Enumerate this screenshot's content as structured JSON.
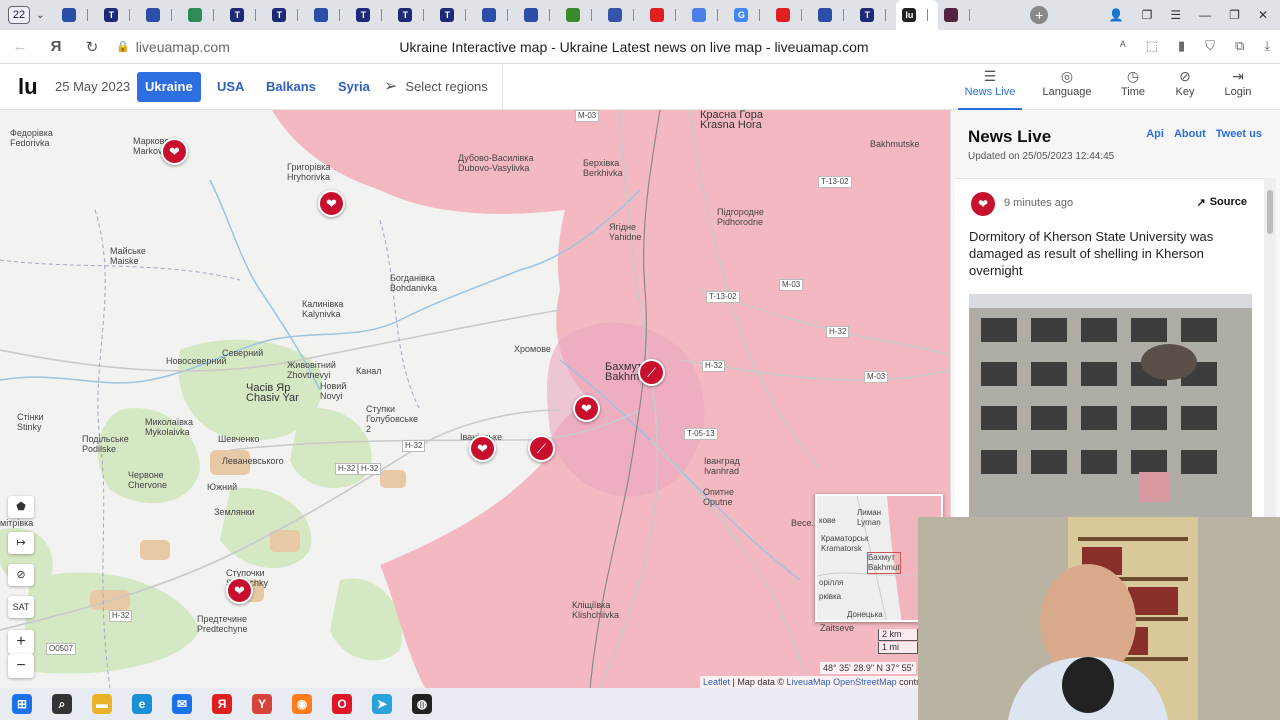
{
  "browser": {
    "tab_count": "22",
    "tabs": [
      {
        "icon": "globe-icon",
        "letter": "",
        "color": "#2b4ea8"
      },
      {
        "icon": "t-icon",
        "letter": "T",
        "color": "#1e2a78"
      },
      {
        "icon": "globe-icon",
        "letter": "",
        "color": "#2b4ea8"
      },
      {
        "icon": "sheet-icon",
        "letter": "",
        "color": "#2e8b57"
      },
      {
        "icon": "t-icon",
        "letter": "T",
        "color": "#1e2a78"
      },
      {
        "icon": "t-icon",
        "letter": "T",
        "color": "#1e2a78"
      },
      {
        "icon": "globe-icon",
        "letter": "",
        "color": "#2b4ea8"
      },
      {
        "icon": "t-icon",
        "letter": "T",
        "color": "#1e2a78"
      },
      {
        "icon": "t-icon",
        "letter": "T",
        "color": "#1e2a78"
      },
      {
        "icon": "t-icon",
        "letter": "T",
        "color": "#1e2a78"
      },
      {
        "icon": "globe-icon",
        "letter": "",
        "color": "#2b4ea8"
      },
      {
        "icon": "globe-icon",
        "letter": "",
        "color": "#2b4ea8"
      },
      {
        "icon": "rt-icon",
        "letter": "",
        "color": "#3a8a2b"
      },
      {
        "icon": "news-icon",
        "letter": "",
        "color": "#3355aa"
      },
      {
        "icon": "youtube-icon",
        "letter": "",
        "color": "#e02020"
      },
      {
        "icon": "translate-icon",
        "letter": "",
        "color": "#4a80e8"
      },
      {
        "icon": "google-icon",
        "letter": "G",
        "color": "#4285f4"
      },
      {
        "icon": "youtube-icon",
        "letter": "",
        "color": "#e02020"
      },
      {
        "icon": "globe-icon",
        "letter": "",
        "color": "#2b4ea8"
      },
      {
        "icon": "t-icon",
        "letter": "T",
        "color": "#1e2a78"
      },
      {
        "icon": "liveuamap-icon",
        "letter": "lu",
        "color": "#222222"
      },
      {
        "icon": "globe-icon",
        "letter": "",
        "color": "#552244"
      }
    ],
    "url": "liveuamap.com",
    "page_title": "Ukraine Interactive map - Ukraine Latest news on live map - liveuamap.com"
  },
  "header": {
    "logo": "lu",
    "date": "25 May 2023",
    "regions": [
      {
        "label": "Ukraine",
        "active": true
      },
      {
        "label": "USA",
        "active": false
      },
      {
        "label": "Balkans",
        "active": false
      },
      {
        "label": "Syria",
        "active": false
      }
    ],
    "select_regions": "Select regions",
    "nav": [
      {
        "label": "News Live",
        "icon": "news-icon",
        "glyph": "☰",
        "active": true
      },
      {
        "label": "Language",
        "icon": "language-icon",
        "glyph": "◎",
        "active": false
      },
      {
        "label": "Time",
        "icon": "clock-icon",
        "glyph": "◷",
        "active": false
      },
      {
        "label": "Key",
        "icon": "compass-icon",
        "glyph": "⊘",
        "active": false
      },
      {
        "label": "Login",
        "icon": "login-icon",
        "glyph": "⇥",
        "active": false
      }
    ]
  },
  "map": {
    "colors": {
      "occupied": "#f3b5bd",
      "base": "#f2f2f0",
      "marker": "#c8102e"
    },
    "labels": [
      {
        "text": "Федорівка\nFedorivka"
      },
      {
        "text": "Маркове\nMarkove"
      },
      {
        "text": "Григорівка\nHryhorivka"
      },
      {
        "text": "Майське\nMaiske"
      },
      {
        "text": "Богданівка\nBohdanivka"
      },
      {
        "text": "Калинівка\nKalynivka"
      },
      {
        "text": "Новосеверний"
      },
      {
        "text": "Северний"
      },
      {
        "text": "Живовітний\nZhovtnevyi"
      },
      {
        "text": "Часів Яр\nChasiv Yar"
      },
      {
        "text": "Новий\nNovyi"
      },
      {
        "text": "Канал"
      },
      {
        "text": "Ступки\nГолубовське\n2"
      },
      {
        "text": "Стінки\nStinky"
      },
      {
        "text": "Миколаївка\nMykolaivka"
      },
      {
        "text": "Подільське\nPodilske"
      },
      {
        "text": "Шевченко"
      },
      {
        "text": "Леваневського"
      },
      {
        "text": "Червоне\nChervone"
      },
      {
        "text": "Южний"
      },
      {
        "text": "Землянки"
      },
      {
        "text": "Ступочки\nStupochky"
      },
      {
        "text": "Предтечине\nPredtechyne"
      },
      {
        "text": "Дубово-Василівка\nDubovo-Vasylivka"
      },
      {
        "text": "Берхівка\nBerkhivka"
      },
      {
        "text": "Ягідне\nYahidne"
      },
      {
        "text": "Підгородне\nPidhorodne"
      },
      {
        "text": "Красна Гора\nKrasna Hora"
      },
      {
        "text": "Хромове"
      },
      {
        "text": "Бахмут\nBakhmut"
      },
      {
        "text": "Іванівське"
      },
      {
        "text": "Іванград\nIvanhrad"
      },
      {
        "text": "Опитне\nOputne"
      },
      {
        "text": "Кліщіївка\nKlishchiivka"
      },
      {
        "text": "Весе..."
      },
      {
        "text": "Zaitseve"
      },
      {
        "text": "Bakhmutske"
      }
    ],
    "roads": [
      "M-03",
      "T-13-02",
      "T-13-02",
      "M-03",
      "H-32",
      "H-32",
      "M-03",
      "H-32",
      "H-32",
      "H-32",
      "H-32",
      "O0507",
      "T-05-13"
    ],
    "markers": [
      "shell",
      "shell",
      "shell",
      "shell",
      "shell",
      "rifle",
      "rifle"
    ],
    "controls": {
      "a": "⬟",
      "b": "мітрівка",
      "c": "↦",
      "d": "⊘",
      "sat": "SAT",
      "plus": "+",
      "minus": "−"
    },
    "minimap_labels": [
      {
        "text": "Лиман\nLyman"
      },
      {
        "text": "Краматорськ\nKramatorsk"
      },
      {
        "text": "Бахмут\nBakhmut"
      },
      {
        "text": "Донецька"
      }
    ],
    "scale": [
      "2 km",
      "1 mi"
    ],
    "coords": "48° 35' 28.9\" N 37° 55'",
    "attribution": {
      "leaflet": "Leaflet",
      "sep": " | Map data © ",
      "liveua": "LiveuaMap",
      "osm": " OpenStreetMap",
      "tail": " contr"
    }
  },
  "news": {
    "title": "News Live",
    "links": [
      "Api",
      "About",
      "Tweet us"
    ],
    "updated": "Updated on 25/05/2023 12:44:45",
    "item": {
      "time": "9 minutes ago",
      "source": "Source",
      "headline": "Dormitory of Kherson State University was damaged as result of shelling in Kherson overnight"
    }
  },
  "taskbar": [
    {
      "icon": "windows-icon",
      "glyph": "⊞",
      "color": "#1a73e8"
    },
    {
      "icon": "search-icon",
      "glyph": "⌕",
      "color": "#333333"
    },
    {
      "icon": "folder-icon",
      "glyph": "▬",
      "color": "#e8b32b"
    },
    {
      "icon": "edge-icon",
      "glyph": "e",
      "color": "#1b8fd6"
    },
    {
      "icon": "mail-icon",
      "glyph": "✉",
      "color": "#1a73e8"
    },
    {
      "icon": "yandex-icon",
      "glyph": "Я",
      "color": "#e02020"
    },
    {
      "icon": "yandex-browser-icon",
      "glyph": "Y",
      "color": "#d8433a"
    },
    {
      "icon": "firefox-icon",
      "glyph": "◉",
      "color": "#ff7b1c"
    },
    {
      "icon": "opera-icon",
      "glyph": "O",
      "color": "#e0162b"
    },
    {
      "icon": "telegram-icon",
      "glyph": "➤",
      "color": "#2aa3dd"
    },
    {
      "icon": "obs-icon",
      "glyph": "◍",
      "color": "#222222"
    }
  ]
}
